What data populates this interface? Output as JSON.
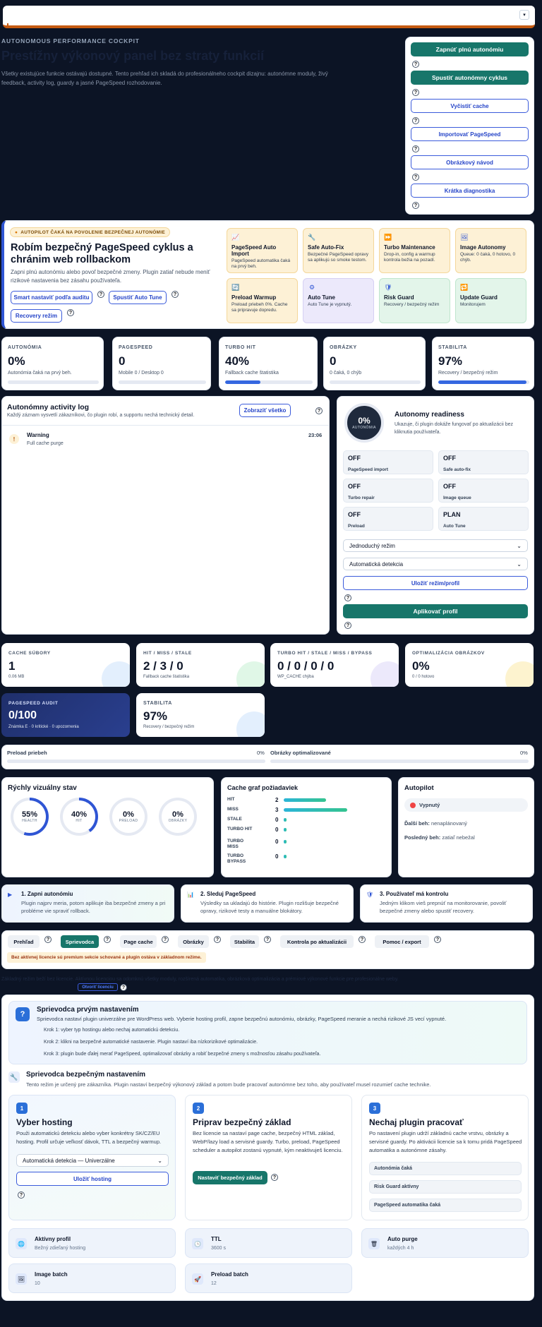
{
  "top": {
    "chevron": "▾"
  },
  "hero": {
    "kicker": "AUTONOMOUS PERFORMANCE COCKPIT",
    "title": "Prestížny výkonový panel bez straty funkcií",
    "desc": "Všetky existujúce funkcie ostávajú dostupné. Tento prehľad ich skladá do profesionálneho cockpit dizajnu: autonómne moduly, živý feedback, activity log, guardy a jasné PageSpeed rozhodovanie."
  },
  "actions": {
    "full": "Zapnúť plnú autonómiu",
    "cycle": "Spustiť autonómny cyklus",
    "cache": "Vyčistiť cache",
    "import": "Importovať PageSpeed",
    "guide": "Obrázkový návod",
    "diag": "Krátka diagnostika"
  },
  "autopilot": {
    "badge": "AUTOPILOT ČAKÁ NA POVOLENIE BEZPEČNEJ AUTONÓMIE",
    "title": "Robím bezpečný PageSpeed cyklus a chránim web rollbackom",
    "desc": "Zapni plnú autonómiu alebo povoľ bezpečné zmeny. Plugin zatiaľ nebude meniť rizikové nastavenia bez zásahu používateľa.",
    "b1": "Smart nastaviť podľa auditu",
    "b2": "Spustiť Auto Tune",
    "b3": "Recovery režim",
    "tiles": [
      {
        "title": "PageSpeed Auto Import",
        "text": "PageSpeed automatika čaká na prvý beh.",
        "bg": "#fdf1d6",
        "border": "#f4d79a",
        "icon": "chart-icon",
        "glyph": "📈"
      },
      {
        "title": "Safe Auto-Fix",
        "text": "Bezpečné PageSpeed opravy sa aplikujú so smoke testom.",
        "bg": "#fdf1d6",
        "border": "#f4d79a",
        "icon": "wrench-icon",
        "glyph": "🔧"
      },
      {
        "title": "Turbo Maintenance",
        "text": "Drop-in, config a warmup kontrola bežia na pozadí.",
        "bg": "#fdf1d6",
        "border": "#f4d79a",
        "icon": "fast-forward-icon",
        "glyph": "⏩"
      },
      {
        "title": "Image Autonomy",
        "text": "Queue: 0 čaká, 0 hotovo, 0 chýb.",
        "bg": "#fdf1d6",
        "border": "#f4d79a",
        "icon": "image-icon",
        "glyph": "🖼"
      },
      {
        "title": "Preload Warmup",
        "text": "Preload priebeh 0%. Cache sa pripravuje dopredu.",
        "bg": "#fdf1d6",
        "border": "#f4d79a",
        "icon": "refresh-icon",
        "glyph": "🔄"
      },
      {
        "title": "Auto Tune",
        "text": "Auto Tune je vypnutý.",
        "bg": "#ece9fb",
        "border": "#d6d0f3",
        "icon": "gear-icon",
        "glyph": "⚙"
      },
      {
        "title": "Risk Guard",
        "text": "Recovery / bezpečný režim",
        "bg": "#e3f5ea",
        "border": "#bfe6cd",
        "icon": "shield-icon",
        "glyph": "🛡"
      },
      {
        "title": "Update Guard",
        "text": "Monitorujem",
        "bg": "#e3f5ea",
        "border": "#bfe6cd",
        "icon": "update-icon",
        "glyph": "🔁"
      }
    ]
  },
  "kpis": [
    {
      "label": "AUTONÓMIA",
      "value": "0%",
      "sub": "Autonómia čaká na prvý beh.",
      "fill": 0
    },
    {
      "label": "PAGESPEED",
      "value": "0",
      "sub": "Mobile 0 / Desktop 0",
      "fill": 0
    },
    {
      "label": "TURBO HIT",
      "value": "40%",
      "sub": "Fallback cache štatistika",
      "fill": 40
    },
    {
      "label": "OBRÁZKY",
      "value": "0",
      "sub": "0 čaká, 0 chýb",
      "fill": 0
    },
    {
      "label": "STABILITA",
      "value": "97%",
      "sub": "Recovery / bezpečný režim",
      "fill": 97
    }
  ],
  "log": {
    "title": "Autonómny activity log",
    "desc": "Každý záznam vysvetlí zákazníkovi, čo plugin robí, a supportu nechá technický detail.",
    "btn": "Zobraziť všetko",
    "entry_title": "Warning",
    "entry_text": "Full cache purge",
    "entry_time": "23:06",
    "entry_icon": "!"
  },
  "readiness": {
    "value": "0%",
    "sub": "AUTONÓMIA",
    "title": "Autonomy readiness",
    "desc": "Ukazuje, či plugin dokáže fungovať po aktualizácii bez kliknutia používateľa.",
    "items": [
      {
        "v": "OFF",
        "l": "PageSpeed import"
      },
      {
        "v": "OFF",
        "l": "Safe auto-fix"
      },
      {
        "v": "OFF",
        "l": "Turbo repair"
      },
      {
        "v": "OFF",
        "l": "Image queue"
      },
      {
        "v": "OFF",
        "l": "Preload"
      },
      {
        "v": "PLAN",
        "l": "Auto Tune"
      }
    ],
    "mode": "Jednoduchý režim",
    "detect": "Automatická detekcia",
    "save": "Uložiť režim/profil",
    "apply": "Aplikovať profil"
  },
  "stats": [
    {
      "label": "CACHE SÚBORY",
      "value": "1",
      "sub": "0.06 MB",
      "blob": "#e3effd"
    },
    {
      "label": "HIT / MISS / STALE",
      "value": "2 / 3 / 0",
      "sub": "Fallback cache štatistika",
      "blob": "#e0f7e7"
    },
    {
      "label": "TURBO HIT / STALE / MISS / BYPASS",
      "value": "0 / 0 / 0 / 0",
      "sub": "WP_CACHE chýba",
      "blob": "#ece9fb"
    },
    {
      "label": "OPTIMALIZÁCIA OBRÁZKOV",
      "value": "0%",
      "sub": "0 / 0 hotovo",
      "blob": "#fdf3cf"
    }
  ],
  "psaudit": {
    "label": "PAGESPEED AUDIT",
    "value": "0/100",
    "sub": "Známka E · 0 kritické · 0 upozornenia"
  },
  "stab": {
    "label": "STABILITA",
    "value": "97%",
    "sub": "Recovery / bezpečný režim"
  },
  "progress": {
    "preload_label": "Preload priebeh",
    "preload_val": "0%",
    "images_label": "Obrázky optimalizované",
    "images_val": "0%"
  },
  "visual": {
    "title": "Rýchly vizuálny stav",
    "rings": [
      {
        "v": "55%",
        "l": "HEALTH",
        "p": 55
      },
      {
        "v": "40%",
        "l": "HIT",
        "p": 40
      },
      {
        "v": "0%",
        "l": "PRELOAD",
        "p": 0
      },
      {
        "v": "0%",
        "l": "OBRÁZKY",
        "p": 0
      }
    ]
  },
  "cachegraph": {
    "title": "Cache graf požiadaviek",
    "rows": [
      {
        "l": "HIT",
        "v": "2",
        "n": 2
      },
      {
        "l": "MISS",
        "v": "3",
        "n": 3
      },
      {
        "l": "STALE",
        "v": "0",
        "n": 0
      },
      {
        "l": "TURBO HIT",
        "v": "0",
        "n": 0
      },
      {
        "l": "TURBO MISS",
        "v": "0",
        "n": 0
      },
      {
        "l": "TURBO BYPASS",
        "v": "0",
        "n": 0
      }
    ]
  },
  "autop": {
    "title": "Autopilot",
    "state": "Vypnutý",
    "next_label": "Ďalší beh:",
    "next_val": "nenaplánovaný",
    "last_label": "Posledný beh:",
    "last_val": "zatiaľ nebežal"
  },
  "steps3": [
    {
      "t": "1. Zapni autonómiu",
      "d": "Plugin najprv meria, potom aplikuje iba bezpečné zmeny a pri probléme vie spraviť rollback.",
      "icon": "play-icon",
      "g": "▶"
    },
    {
      "t": "2. Sleduj PageSpeed",
      "d": "Výsledky sa ukladajú do histórie. Plugin rozlišuje bezpečné opravy, rizikové testy a manuálne blokátory.",
      "icon": "bar-chart-icon",
      "g": "📊"
    },
    {
      "t": "3. Používateľ má kontrolu",
      "d": "Jedným klikom vieš prepnúť na monitorovanie, povoliť bezpečné zmeny alebo spustiť recovery.",
      "icon": "shield-check-icon",
      "g": "🛡"
    }
  ],
  "tabs": [
    "Prehľad",
    "Sprievodca",
    "Page cache",
    "Obrázky",
    "Stabilita",
    "Kontrola po aktualizácii",
    "Pomoc / export"
  ],
  "license_warn": "Bez aktívnej licencie sú premium sekcie schované a plugin ostáva v základnom režime.",
  "hidden_note": "Základný režim beží bez licencie. Aktívnou licenciou sa odomknú všetky moduly, rozšírená automatika, obrázková optimalizácia a prémiové výkonové funkcie pre profesionálne weby.",
  "license_btn": "Otvoriť licenciu",
  "wizard": {
    "title": "Sprievodca prvým nastavením",
    "desc": "Sprievodca nastaví plugin univerzálne pre WordPress web. Vyberie hosting profil, zapne bezpečnú autonómiu, obrázky, PageSpeed meranie a nechá rizikové JS vecí vypnuté.",
    "s1": "Krok 1: vyber typ hostingu alebo nechaj automatickú detekciu.",
    "s2": "Krok 2: klikni na bezpečné automatické nastavenie. Plugin nastaví iba nízkorizikové optimalizácie.",
    "s3": "Krok 3: plugin bude ďalej merať PageSpeed, optimalizovať obrázky a robiť bezpečné zmeny s možnosťou zásahu používateľa."
  },
  "safe": {
    "title": "Sprievodca bezpečným nastavením",
    "desc": "Tento režim je určený pre zákazníka. Plugin nastaví bezpečný výkonový základ a potom bude pracovať autonómne bez toho, aby používateľ musel rozumieť cache technike.",
    "c1": {
      "n": "1",
      "t": "Vyber hosting",
      "d": "Použi automatickú detekciu alebo vyber konkrétny SK/CZ/EU hosting. Profil určuje veľkosť dávok, TTL a bezpečný warmup.",
      "sel": "Automatická detekcia — Univerzálne",
      "btn": "Uložiť hosting"
    },
    "c2": {
      "n": "2",
      "t": "Priprav bezpečný základ",
      "d": "Bez licencie sa nastaví page cache, bezpečný HTML základ, WebP/lazy load a servisné guardy. Turbo, preload, PageSpeed scheduler a autopilot zostanú vypnuté, kým neaktivuješ licenciu.",
      "btn": "Nastaviť bezpečný základ"
    },
    "c3": {
      "n": "3",
      "t": "Nechaj plugin pracovať",
      "d": "Po nastavení plugin udrží základnú cache vrstvu, obrázky a servisné guardy. Po aktivácii licencie sa k tomu pridá PageSpeed automatika a autonómne zásahy.",
      "i1": "Autonómia čaká",
      "i2": "Risk Guard aktívny",
      "i3": "PageSpeed automatika čaká"
    }
  },
  "infos": [
    {
      "t": "Aktívny profil",
      "v": "Bežný zdieľaný hosting",
      "icon": "globe-icon",
      "g": "🌐"
    },
    {
      "t": "TTL",
      "v": "3600 s",
      "icon": "clock-icon",
      "g": "🕒"
    },
    {
      "t": "Auto purge",
      "v": "každých 4 h",
      "icon": "trash-icon",
      "g": "🗑"
    },
    {
      "t": "Image batch",
      "v": "10",
      "icon": "images-icon",
      "g": "🖼"
    },
    {
      "t": "Preload batch",
      "v": "12",
      "icon": "rocket-icon",
      "g": "🚀"
    }
  ]
}
